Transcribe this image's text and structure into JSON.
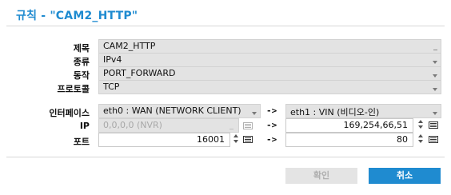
{
  "dialog": {
    "title": "규칙 - \"CAM2_HTTP\""
  },
  "form": {
    "name_label": "제목",
    "name_value": "CAM2_HTTP",
    "type_label": "종류",
    "type_value": "IPv4",
    "action_label": "동작",
    "action_value": "PORT_FORWARD",
    "protocol_label": "프로토콜",
    "protocol_value": "TCP",
    "interface_label": "인터페이스",
    "interface_src": "eth0 : WAN (NETWORK CLIENT)",
    "interface_dst": "eth1 : VIN (비디오-인)",
    "ip_label": "IP",
    "ip_src_value": "0,0,0,0 (NVR)",
    "ip_dst_value": "169,254,66,51",
    "port_label": "포트",
    "port_src_value": "16001",
    "port_dst_value": "80",
    "arrow": "->"
  },
  "buttons": {
    "ok_label": "확인",
    "cancel_label": "취소"
  },
  "colors": {
    "accent": "#1f8bd0",
    "field_bg": "#e3e3e3",
    "disabled_text": "#a8a8a8"
  }
}
